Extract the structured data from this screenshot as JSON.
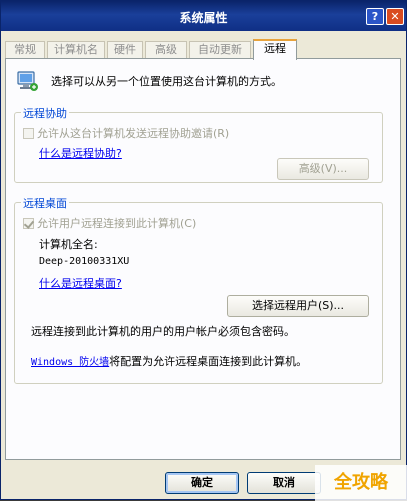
{
  "window": {
    "title": "系统属性"
  },
  "title_buttons": {
    "help": "?",
    "close": "✕"
  },
  "tabs": [
    {
      "label": "常规"
    },
    {
      "label": "计算机名"
    },
    {
      "label": "硬件"
    },
    {
      "label": "高级"
    },
    {
      "label": "自动更新"
    },
    {
      "label": "远程",
      "active": true
    }
  ],
  "intro": {
    "text": "选择可以从另一个位置使用这台计算机的方式。",
    "icon": "computer-network-icon"
  },
  "remote_assistance": {
    "title": "远程协助",
    "checkbox_label": "允许从这台计算机发送远程协助邀请(R)",
    "checked": false,
    "link": "什么是远程协助?",
    "advanced_button": "高级(V)..."
  },
  "remote_desktop": {
    "title": "远程桌面",
    "checkbox_label": "允许用户远程连接到此计算机(C)",
    "checked": true,
    "fullname_label": "计算机全名:",
    "fullname_value": "Deep-20100331XU",
    "link": "什么是远程桌面?",
    "select_users_button": "选择远程用户(S)...",
    "password_note": "远程连接到此计算机的用户的用户帐户必须包含密码。",
    "firewall_link": "Windows 防火墙",
    "firewall_text": "将配置为允许远程桌面连接到此计算机。"
  },
  "footer": {
    "ok": "确定",
    "cancel": "取消"
  },
  "watermark": {
    "text": "全攻略"
  },
  "colors": {
    "titlebar": "#0a246a",
    "group_title": "#0046d5",
    "link": "#0000ee",
    "dialog_bg": "#ece9d8"
  }
}
